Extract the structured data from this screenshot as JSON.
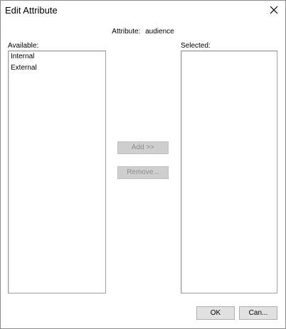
{
  "window": {
    "title": "Edit Attribute",
    "close_icon": "close-icon"
  },
  "attribute": {
    "label": "Attribute:",
    "value": "audience"
  },
  "available": {
    "label": "Available:",
    "items": [
      "Internal",
      "External"
    ]
  },
  "selected": {
    "label": "Selected:",
    "items": []
  },
  "buttons": {
    "add": "Add >>",
    "remove": "Remove...",
    "ok": "OK",
    "cancel": "Can..."
  }
}
